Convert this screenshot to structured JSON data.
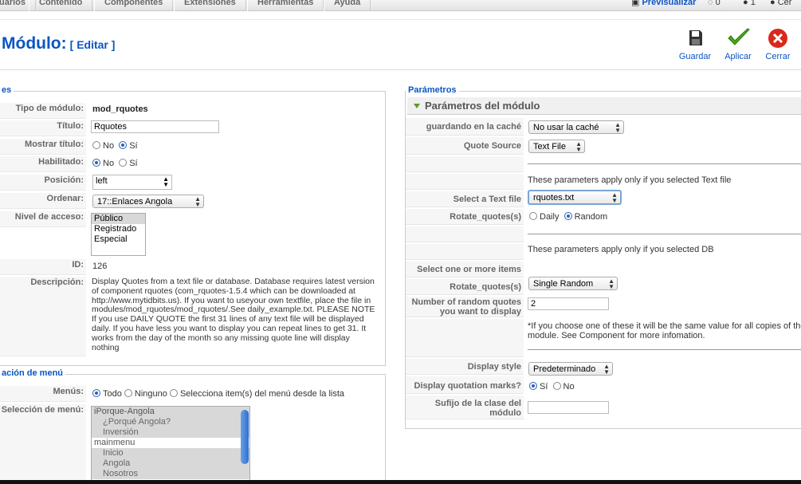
{
  "menu": {
    "items": [
      "uarios",
      "Contenido",
      "Componentes",
      "Extensiones",
      "Herramientas",
      "Ayuda"
    ],
    "preview": "Previsualizar",
    "count1": "0",
    "count2": "1",
    "close_partial": "Cer"
  },
  "toolbar": {
    "title": "Módulo:",
    "subtitle": "[ Editar ]",
    "save_label": "Guardar",
    "apply_label": "Aplicar",
    "close_label": "Cerrar"
  },
  "details": {
    "legend": "es",
    "module_type_label": "Tipo de módulo:",
    "module_type": "mod_rquotes",
    "title_label": "Título:",
    "title_value": "Rquotes",
    "show_title_label": "Mostrar título:",
    "no": "No",
    "yes": "Sí",
    "enabled_label": "Habilitado:",
    "position_label": "Posición:",
    "position_value": "left",
    "order_label": "Ordenar:",
    "order_value": "17::Enlaces Angola",
    "access_label": "Nivel de acceso:",
    "access_options": [
      "Público",
      "Registrado",
      "Especial"
    ],
    "id_label": "ID:",
    "id_value": "126",
    "description_label": "Descripción:",
    "description": "Display Quotes from a text file or database. Database requires latest version of component rquotes (com_rquotes-1.5.4 which can be downloaded at http://www.mytidbits.us). If you want to useyour own textfile, place the file in modules/mod_rquotes/mod_rquotes/.See daily_example.txt. PLEASE NOTE If you use DAILY QUOTE the first 31 lines of any text file will be displayed daily. If you have less you want to display you can repeat lines to get 31. It works from the day of the month so any missing quote line will display nothing"
  },
  "menu_assign": {
    "legend": "ación de menú",
    "menus_label": "Menús:",
    "all": "Todo",
    "none": "Ninguno",
    "select": "Selecciona item(s) del menú desde la lista",
    "selection_label": "Selección de menú:",
    "items": [
      {
        "text": "iPorque-Angola",
        "sub": false
      },
      {
        "text": "¿Porqué Angola?",
        "sub": true
      },
      {
        "text": "Inversión",
        "sub": true
      },
      {
        "text": "mainmenu",
        "sub": false
      },
      {
        "text": "Inicio",
        "sub": true
      },
      {
        "text": "Angola",
        "sub": true
      },
      {
        "text": "Nosotros",
        "sub": true
      }
    ]
  },
  "params": {
    "legend": "Parámetros",
    "header": "Parámetros del módulo",
    "cache_label": "guardando en la caché",
    "cache_value": "No usar la caché",
    "source_label": "Quote Source",
    "source_value": "Text File",
    "note_text": "These parameters apply only if you selected Text file",
    "textfile_label": "Select a Text file",
    "textfile_value": "rquotes.txt",
    "rotate_label": "Rotate_quotes(s)",
    "daily": "Daily",
    "random": "Random",
    "note_db": "These parameters apply only if you selected DB",
    "select_items_label": "Select one or more items",
    "rotate2_label": "Rotate_quotes(s)",
    "rotate2_value": "Single Random",
    "num_label": "Number of random quotes you want to display",
    "num_value": "2",
    "note_choose": "*If you choose one of these it will be the same value for all copies of the module. See Component for more infomation.",
    "style_label": "Display style",
    "style_value": "Predeterminado",
    "marks_label": "Display quotation marks?",
    "yes": "Sí",
    "no": "No",
    "suffix_label": "Sufijo de la clase del módulo",
    "suffix_value": ""
  }
}
